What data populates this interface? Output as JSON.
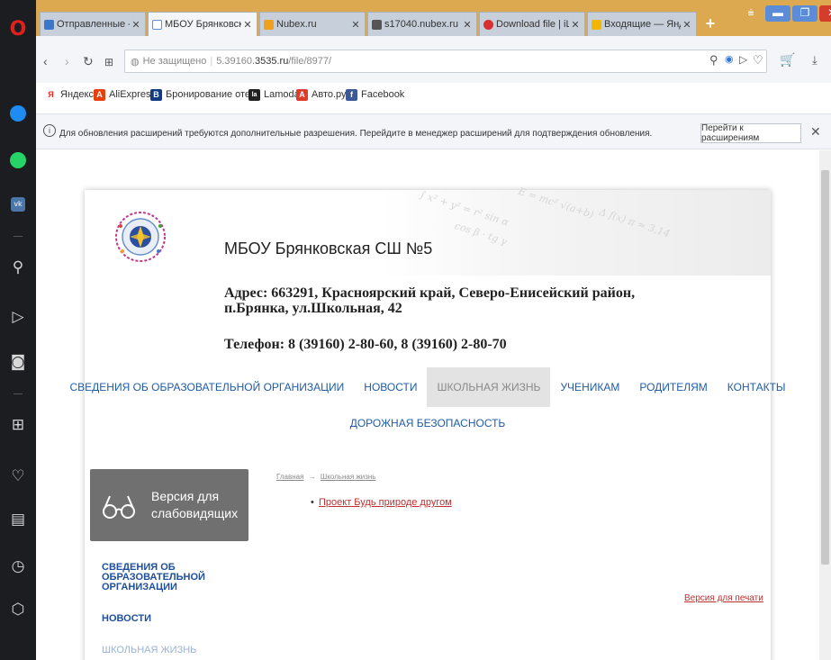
{
  "browser": {
    "tabs": [
      {
        "title": "Отправленные - Поч",
        "color": "#3a77c9"
      },
      {
        "title": "МБОУ Брянковская С",
        "color": "#5b8fd6"
      },
      {
        "title": "Nubex.ru",
        "color": "#f0a020"
      },
      {
        "title": "s17040.nubex.ru",
        "color": "#555555"
      },
      {
        "title": "Download file | iLove",
        "color": "#d82f2f"
      },
      {
        "title": "Входящие — Яндекс",
        "color": "#f2b500"
      }
    ],
    "new_tab": "+",
    "url": {
      "security": "Не защищено",
      "prefix": "5.39160.",
      "host": "3535.ru",
      "path": "/file/8977/"
    },
    "bookmarks": [
      {
        "label": "Яндекс",
        "icon": "yandex-icon",
        "color": "#e52620",
        "glyph": "Я"
      },
      {
        "label": "AliExpress",
        "icon": "aliexpress-icon",
        "color": "#e8400c",
        "glyph": "A"
      },
      {
        "label": "Бронирование отел",
        "icon": "booking-icon",
        "color": "#123b84",
        "glyph": "B"
      },
      {
        "label": "Lamoda",
        "icon": "lamoda-icon",
        "color": "#222222",
        "glyph": "la"
      },
      {
        "label": "Авто.ру",
        "icon": "auto-icon",
        "color": "#e03a2c",
        "glyph": "A"
      },
      {
        "label": "Facebook",
        "icon": "facebook-icon",
        "color": "#3b5998",
        "glyph": "f"
      }
    ],
    "notice": {
      "text": "Для обновления расширений требуются дополнительные разрешения. Перейдите в менеджер расширений для подтверждения обновления.",
      "button": "Перейти к расширениям"
    }
  },
  "site": {
    "school_name": "МБОУ Брянковская СШ №5",
    "address": "Адрес: 663291, Красноярский край, Северо-Енисейский район, п.Брянка, ул.Школьная, 42",
    "phone": "Телефон: 8 (39160) 2-80-60, 8 (39160) 2-80-70",
    "nav": [
      {
        "label": "СВЕДЕНИЯ ОБ ОБРАЗОВАТЕЛЬНОЙ ОРГАНИЗАЦИИ",
        "active": false
      },
      {
        "label": "НОВОСТИ",
        "active": false
      },
      {
        "label": "ШКОЛЬНАЯ ЖИЗНЬ",
        "active": true
      },
      {
        "label": "УЧЕНИКАМ",
        "active": false
      },
      {
        "label": "РОДИТЕЛЯМ",
        "active": false
      },
      {
        "label": "КОНТАКТЫ",
        "active": false
      }
    ],
    "nav_row2": "ДОРОЖНАЯ БЕЗОПАСНОСТЬ",
    "vision_button": "Версия для слабовидящих",
    "breadcrumb": {
      "home": "Главная",
      "separator": "→",
      "current": "Школьная жизнь"
    },
    "content_link": "Проект Будь природе другом",
    "content_bullet": "•",
    "side_menu": [
      "СВЕДЕНИЯ ОБ ОБРАЗОВАТЕЛЬНОЙ ОРГАНИЗАЦИИ",
      "НОВОСТИ",
      "ШКОЛЬНАЯ ЖИЗНЬ"
    ],
    "print_link": "Версия для печати"
  }
}
